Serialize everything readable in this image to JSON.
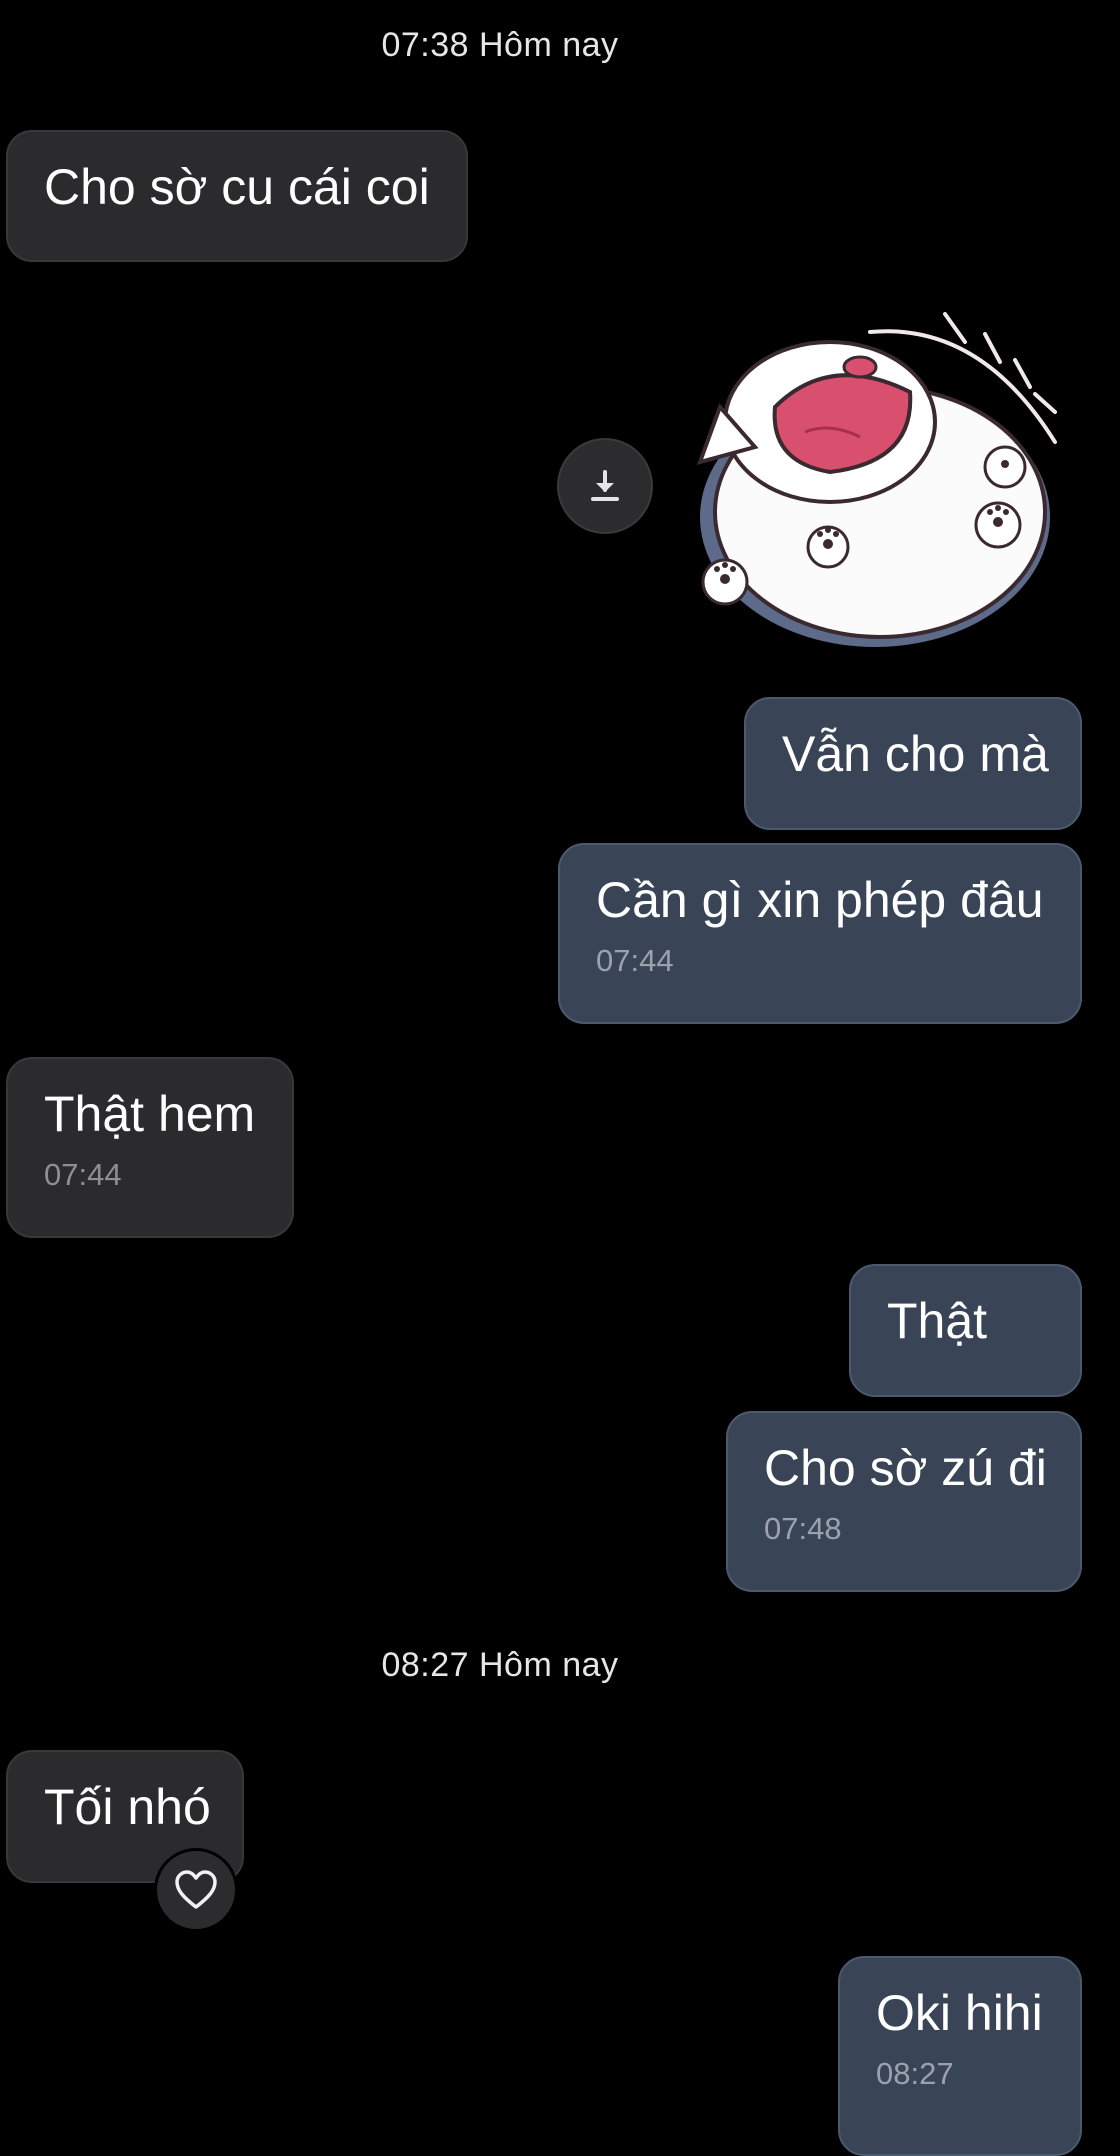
{
  "conversation": {
    "date_dividers": [
      {
        "text": "07:38 Hôm nay"
      },
      {
        "text": "08:27 Hôm nay"
      }
    ],
    "messages": [
      {
        "direction": "incoming",
        "text": "Cho sờ cu cái coi",
        "time": null
      },
      {
        "direction": "outgoing",
        "type": "sticker",
        "icon": "download-icon"
      },
      {
        "direction": "outgoing",
        "text": "Vẫn cho mà",
        "time": null
      },
      {
        "direction": "outgoing",
        "text": "Cần gì xin phép đâu",
        "time": "07:44"
      },
      {
        "direction": "incoming",
        "text": "Thật hem",
        "time": "07:44"
      },
      {
        "direction": "outgoing",
        "text": "Thật",
        "time": null
      },
      {
        "direction": "outgoing",
        "text": "Cho sờ zú đi",
        "time": "07:48"
      },
      {
        "direction": "incoming",
        "text": "Tối nhó",
        "time": null,
        "reaction_icon": "heart-icon"
      },
      {
        "direction": "outgoing",
        "text": "Oki hihi",
        "time": "08:27"
      }
    ]
  },
  "colors": {
    "background": "#000000",
    "incoming_bubble": "#2b2b2d",
    "outgoing_bubble": "#394556",
    "timestamp_text": "#9aa2ad"
  }
}
